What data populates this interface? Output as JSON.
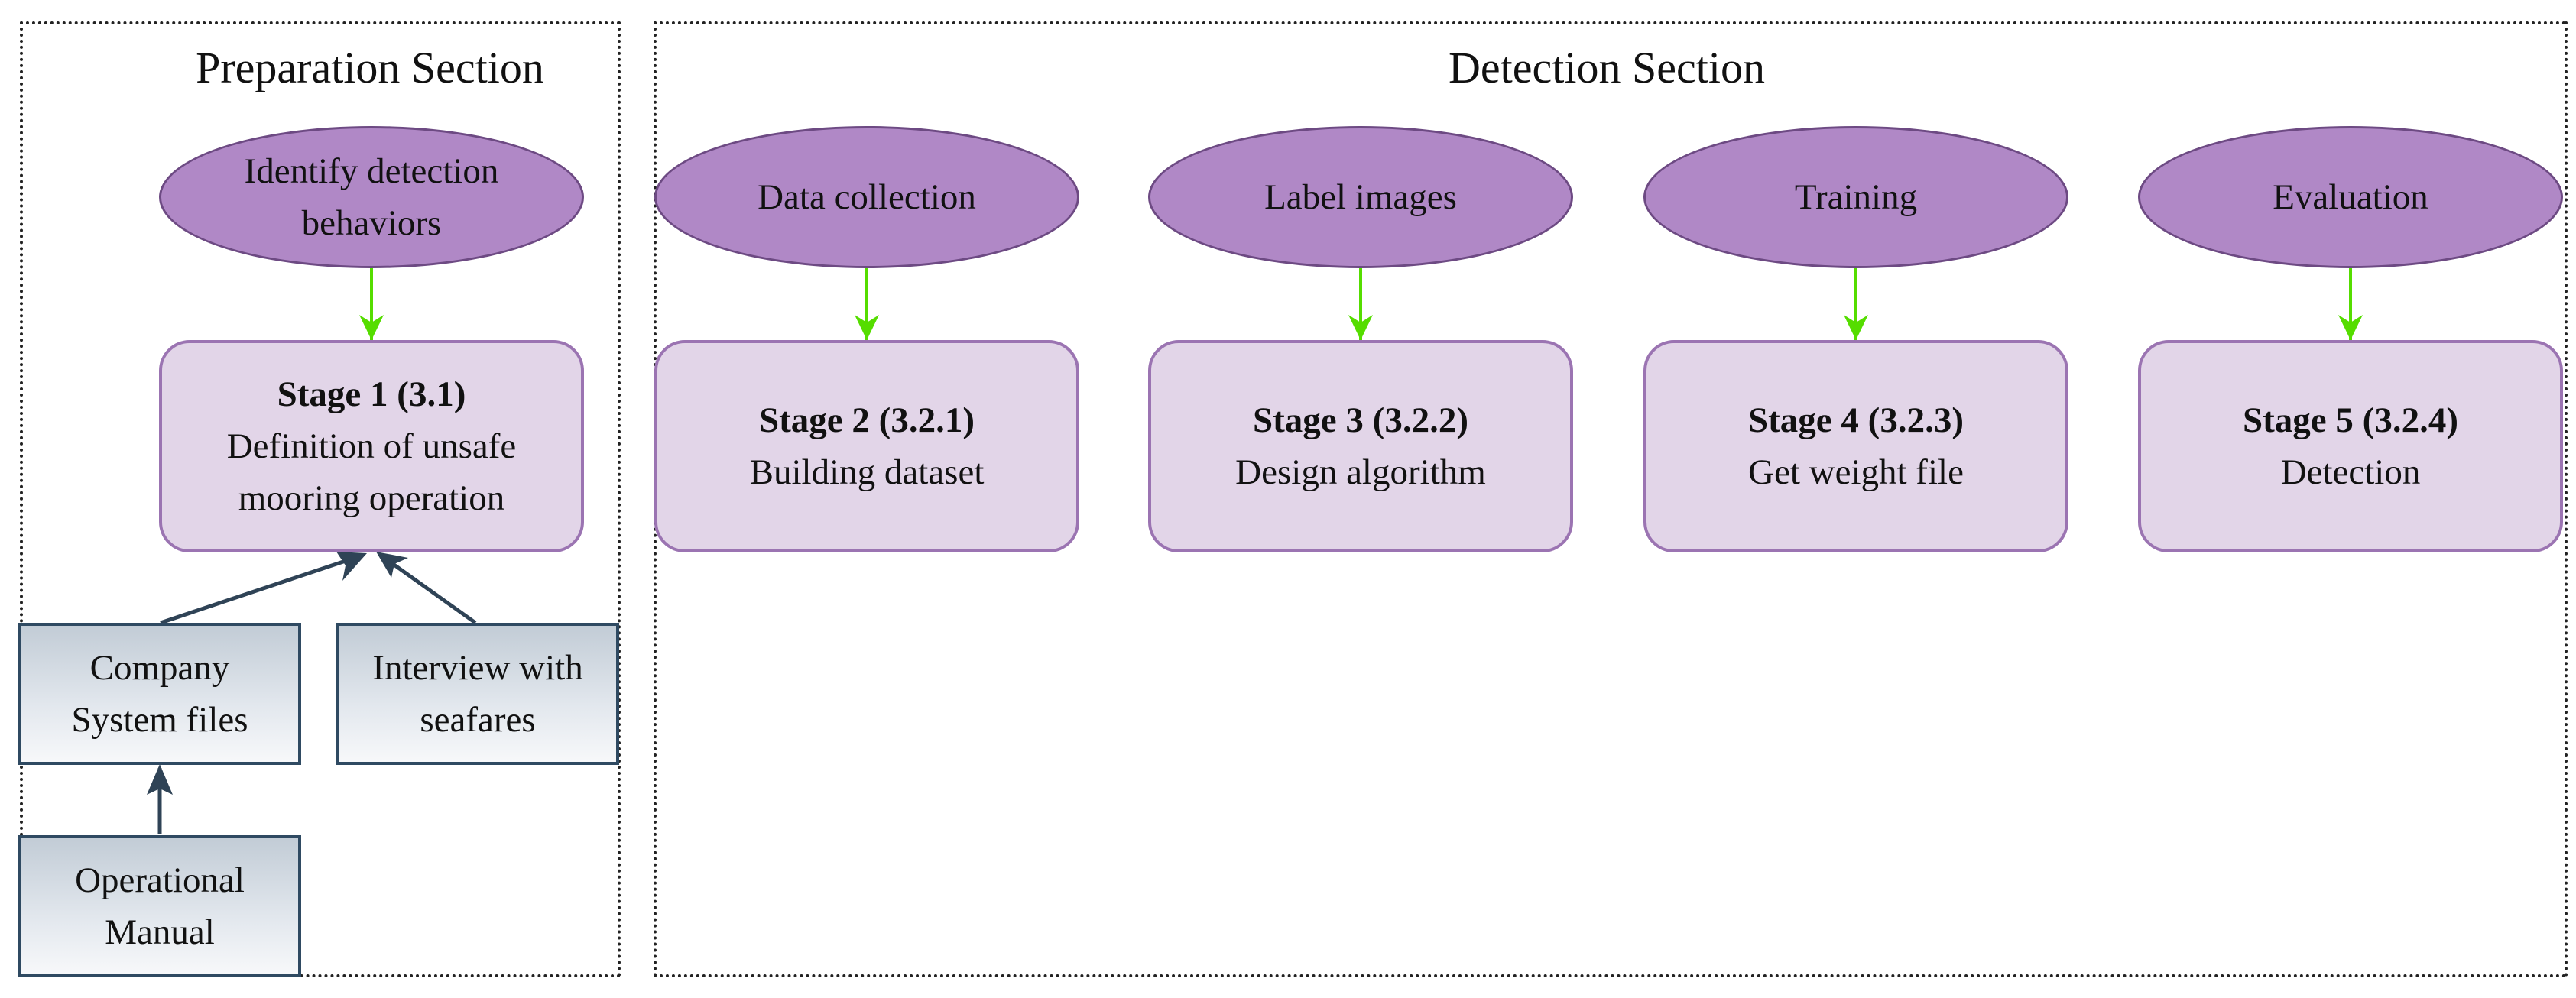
{
  "sections": {
    "preparation": {
      "title": "Preparation Section"
    },
    "detection": {
      "title": "Detection Section"
    }
  },
  "preparation": {
    "goal": {
      "lines": [
        "Identify detection",
        "behaviors"
      ]
    },
    "stage": {
      "title": "Stage 1 (3.1)",
      "lines": [
        "Definition of unsafe",
        "mooring operation"
      ]
    },
    "sources": [
      {
        "lines": [
          "Company",
          "System files"
        ]
      },
      {
        "lines": [
          "Interview with",
          "seafares"
        ]
      },
      {
        "lines": [
          "Operational",
          "Manual"
        ]
      }
    ]
  },
  "detection": {
    "steps": [
      {
        "activity": "Data collection",
        "stage_title": "Stage 2 (3.2.1)",
        "stage_desc": "Building dataset"
      },
      {
        "activity": "Label images",
        "stage_title": "Stage 3 (3.2.2)",
        "stage_desc": "Design algorithm"
      },
      {
        "activity": "Training",
        "stage_title": "Stage 4 (3.2.3)",
        "stage_desc": "Get weight file"
      },
      {
        "activity": "Evaluation",
        "stage_title": "Stage 5 (3.2.4)",
        "stage_desc": "Detection"
      }
    ]
  },
  "colors": {
    "ellipse_fill": "#b088c6",
    "stage_fill": "#e2d5e8",
    "green_arrow": "#55dd00",
    "dark_arrow": "#2f4356",
    "source_border": "#2f4a62"
  }
}
